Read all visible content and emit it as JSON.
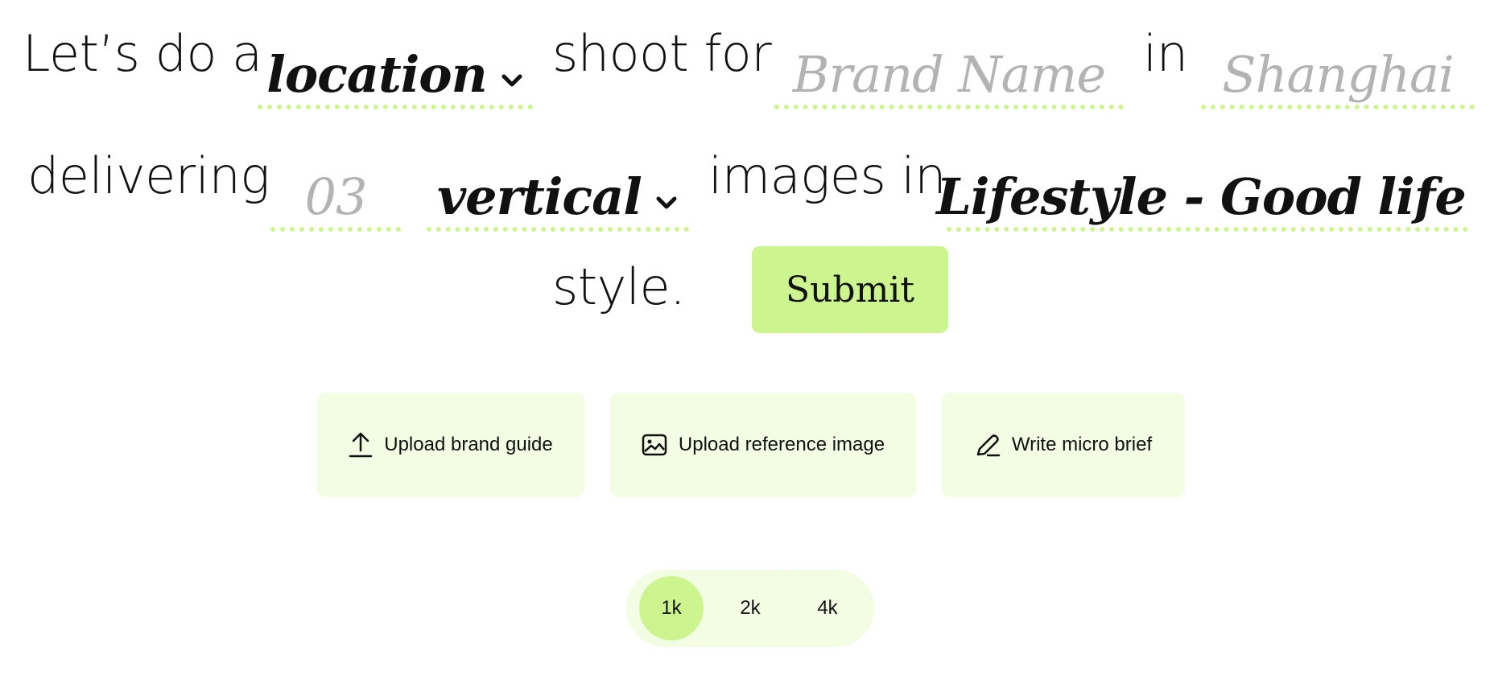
{
  "sentence": {
    "lead_text": "Let’s do a",
    "shoot_type": "location",
    "for_text": "shoot for",
    "brand_placeholder": "Brand Name",
    "in_text": "in",
    "city_placeholder": "Shanghai",
    "delivering_text": "delivering",
    "count_placeholder": "03",
    "orientation": "vertical",
    "images_in_text": "images in",
    "style_value": "Lifestyle - Good life",
    "style_text": "style."
  },
  "submit_label": "Submit",
  "actions": {
    "upload_brand_guide": "Upload brand guide",
    "upload_reference_image": "Upload reference image",
    "write_micro_brief": "Write micro brief"
  },
  "resolution": {
    "options": [
      "1k",
      "2k",
      "4k"
    ],
    "selected": "1k"
  },
  "colors": {
    "accent": "#cdf58f",
    "accent_light": "#f2fde3",
    "placeholder": "#b3b3b3",
    "text": "#111111"
  }
}
